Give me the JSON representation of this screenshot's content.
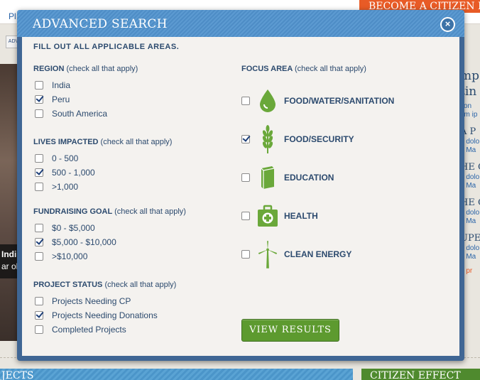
{
  "background": {
    "nav_fragment": "Pl",
    "citizen_banner": "BECOME A CITIZEN P",
    "ad_button": "ADV",
    "photo_caption_line1": "Indi",
    "photo_caption_line2": "ar ol",
    "right_col": {
      "heading1": "mp",
      "heading2": "tin",
      "small1": "con",
      "small2": "em ip",
      "teasers": [
        {
          "title": "A P",
          "line1": "n dolo",
          "line2": "t. Ma"
        },
        {
          "title": "HE C",
          "line1": "n dolo",
          "line2": "t. Ma"
        },
        {
          "title": "HE CA",
          "line1": "n dolo",
          "line2": "t. Ma"
        },
        {
          "title": "UPE",
          "line1": "n dolo",
          "line2": "t. Ma"
        }
      ],
      "more": "e pr"
    },
    "projects_bar": "JECTS",
    "effect_bar": "CITIZEN EFFECT"
  },
  "modal": {
    "title": "ADVANCED SEARCH",
    "close_label": "×",
    "instructions": "FILL OUT ALL APPLICABLE AREAS.",
    "region": {
      "title": "REGION",
      "hint": "(check all that apply)",
      "options": [
        {
          "label": "India",
          "checked": false
        },
        {
          "label": "Peru",
          "checked": true
        },
        {
          "label": "South America",
          "checked": false
        }
      ]
    },
    "lives_impacted": {
      "title": "LIVES IMPACTED",
      "hint": "(check all that apply)",
      "options": [
        {
          "label": "0 - 500",
          "checked": false
        },
        {
          "label": "500 - 1,000",
          "checked": true
        },
        {
          "label": ">1,000",
          "checked": false
        }
      ]
    },
    "fundraising_goal": {
      "title": "FUNDRAISING GOAL",
      "hint": "(check all that apply)",
      "options": [
        {
          "label": "$0 - $5,000",
          "checked": false
        },
        {
          "label": "$5,000 - $10,000",
          "checked": true
        },
        {
          "label": ">$10,000",
          "checked": false
        }
      ]
    },
    "project_status": {
      "title": "PROJECT STATUS",
      "hint": "(check all that apply)",
      "options": [
        {
          "label": "Projects Needing CP",
          "checked": false
        },
        {
          "label": "Projects Needing Donations",
          "checked": true
        },
        {
          "label": "Completed Projects",
          "checked": false
        }
      ]
    },
    "focus_area": {
      "title": "FOCUS AREA",
      "hint": "(check all that apply)",
      "options": [
        {
          "label": "FOOD/WATER/SANITATION",
          "icon": "water-drop-icon",
          "checked": false
        },
        {
          "label": "FOOD/SECURITY",
          "icon": "wheat-icon",
          "checked": true
        },
        {
          "label": "EDUCATION",
          "icon": "book-icon",
          "checked": false
        },
        {
          "label": "HEALTH",
          "icon": "first-aid-kit-icon",
          "checked": false
        },
        {
          "label": "CLEAN ENERGY",
          "icon": "wind-turbine-icon",
          "checked": false
        }
      ]
    },
    "view_results": "VIEW RESULTS"
  },
  "colors": {
    "modal_frame": "#3f6694",
    "modal_header": "#4e8dc6",
    "body_text": "#2c4a6e",
    "icon_green": "#6aa83a",
    "button_green": "#5d9a2f",
    "citizen_orange": "#e85b26"
  }
}
